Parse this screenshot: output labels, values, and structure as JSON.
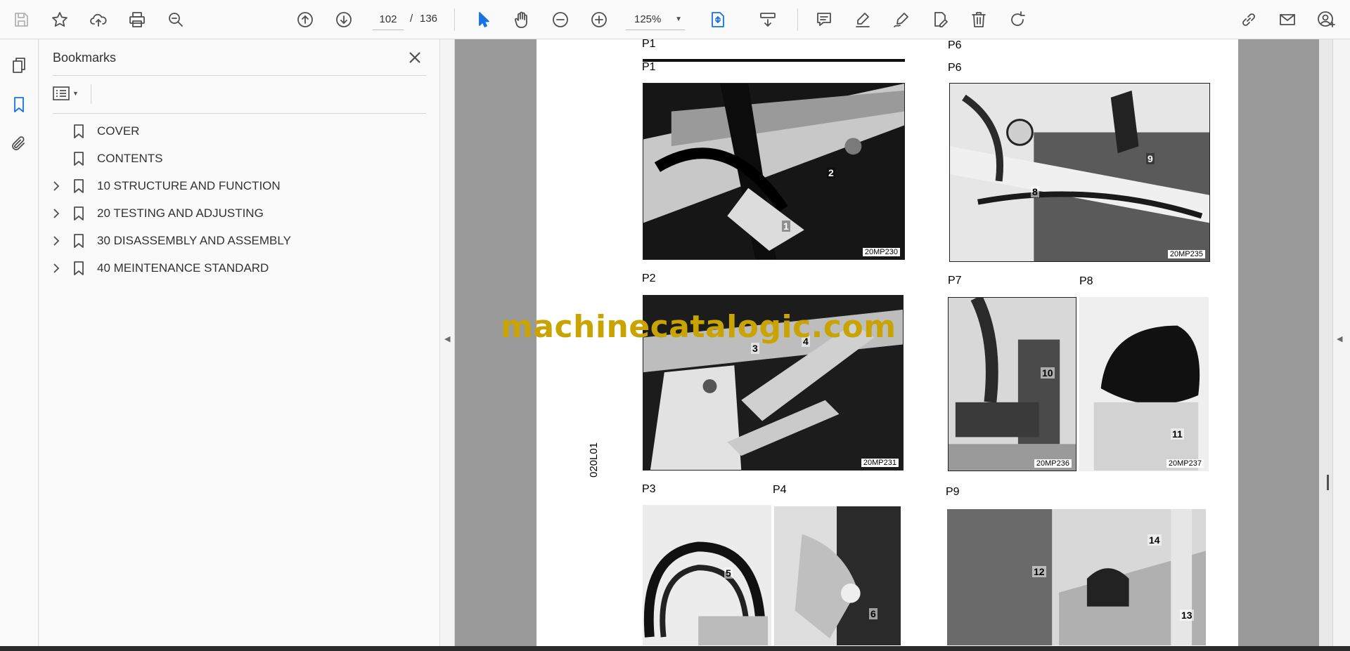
{
  "toolbar": {
    "page_current": "102",
    "page_separator": "/",
    "page_total": "136",
    "zoom_value": "125%"
  },
  "panel": {
    "title": "Bookmarks",
    "bookmarks": [
      {
        "label": "COVER",
        "expandable": false
      },
      {
        "label": "CONTENTS",
        "expandable": false
      },
      {
        "label": "10 STRUCTURE AND FUNCTION",
        "expandable": true
      },
      {
        "label": "20 TESTING AND ADJUSTING",
        "expandable": true
      },
      {
        "label": "30 DISASSEMBLY AND ASSEMBLY",
        "expandable": true
      },
      {
        "label": "40 MEINTENANCE STANDARD",
        "expandable": true
      }
    ]
  },
  "document": {
    "top_left_label": "P1",
    "top_right_label": "P6",
    "photos": [
      {
        "label": "P1",
        "code": "20MP230",
        "callouts": [
          "2",
          "1"
        ]
      },
      {
        "label": "P6",
        "code": "20MP235",
        "callouts": [
          "9",
          "8"
        ]
      },
      {
        "label": "P2",
        "code": "20MP231",
        "callouts": [
          "3",
          "4"
        ]
      },
      {
        "label": "P7",
        "code": "20MP236",
        "callouts": [
          "10"
        ]
      },
      {
        "label": "P8",
        "code": "20MP237",
        "callouts": [
          "11"
        ]
      },
      {
        "label": "P3",
        "code": "",
        "callouts": [
          "5"
        ]
      },
      {
        "label": "P4",
        "code": "",
        "callouts": [
          "6"
        ]
      },
      {
        "label": "P9",
        "code": "",
        "callouts": [
          "14",
          "12",
          "13"
        ]
      }
    ],
    "side_code": "020L01",
    "watermark": "machinecatalogic.com"
  }
}
